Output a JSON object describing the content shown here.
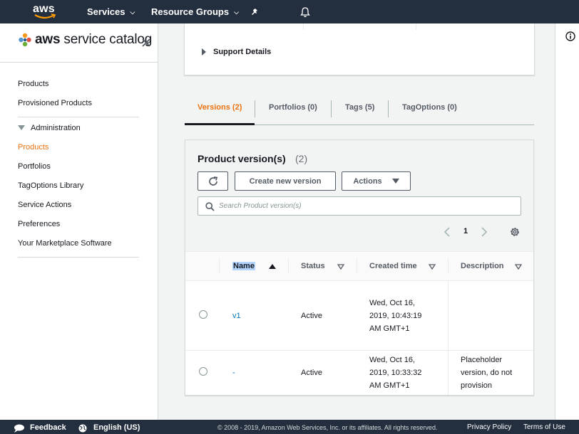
{
  "topnav": {
    "logo": "aws",
    "services": "Services",
    "resource_groups": "Resource Groups",
    "icons": [
      "pin-icon",
      "bell-icon"
    ]
  },
  "sidebar": {
    "brand_prefix": "aws",
    "brand_name": "service catalog",
    "items": [
      {
        "label": "Products",
        "active": false
      },
      {
        "label": "Provisioned Products",
        "active": false
      }
    ],
    "admin_header": "Administration",
    "admin_items": [
      {
        "label": "Products",
        "active": true
      },
      {
        "label": "Portfolios",
        "active": false
      },
      {
        "label": "TagOptions Library",
        "active": false
      },
      {
        "label": "Service Actions",
        "active": false
      },
      {
        "label": "Preferences",
        "active": false
      },
      {
        "label": "Your Marketplace Software",
        "active": false
      }
    ]
  },
  "details": {
    "support_details": "Support Details"
  },
  "tabs": [
    {
      "label": "Versions (2)",
      "active": true
    },
    {
      "label": "Portfolios (0)",
      "active": false
    },
    {
      "label": "Tags (5)",
      "active": false
    },
    {
      "label": "TagOptions (0)",
      "active": false
    }
  ],
  "versions": {
    "title": "Product version(s)",
    "count": "(2)",
    "create_button": "Create new version",
    "actions_button": "Actions",
    "search_placeholder": "Search Product version(s)",
    "page": "1",
    "columns": [
      "Name",
      "Status",
      "Created time",
      "Description"
    ],
    "sort": {
      "column": "Name",
      "direction": "ascending"
    },
    "rows": [
      {
        "name": "v1",
        "status": "Active",
        "created": [
          "Wed, Oct 16,",
          "2019, 10:43:19",
          "AM GMT+1"
        ],
        "description": [
          "",
          "",
          ""
        ]
      },
      {
        "name": "-",
        "status": "Active",
        "created": [
          "Wed, Oct 16,",
          "2019, 10:33:32",
          "AM GMT+1"
        ],
        "description": [
          "Placeholder",
          "version, do not",
          "provision"
        ]
      }
    ]
  },
  "footer": {
    "feedback": "Feedback",
    "language": "English (US)",
    "copyright": "© 2008 - 2019, Amazon Web Services, Inc. or its affiliates. All rights reserved.",
    "privacy": "Privacy Policy",
    "terms": "Terms of Use"
  },
  "colors": {
    "nav_bg": "#232f3e",
    "accent": "#ec7211",
    "link": "#0073bb",
    "highlight": "#b4d5fe"
  }
}
